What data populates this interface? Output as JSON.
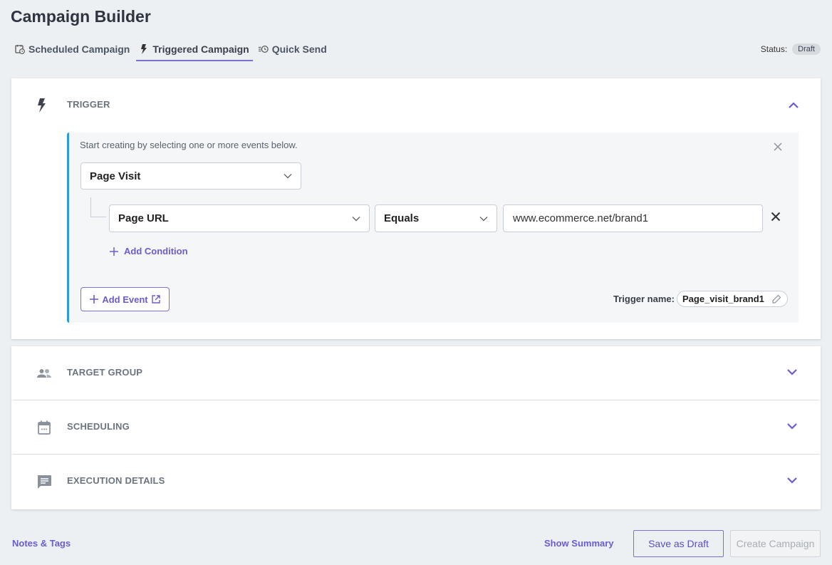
{
  "page": {
    "title": "Campaign Builder"
  },
  "tabs": [
    {
      "label": "Scheduled Campaign",
      "icon": "calendar-clock-icon",
      "active": false
    },
    {
      "label": "Triggered Campaign",
      "icon": "lightning-icon",
      "active": true
    },
    {
      "label": "Quick Send",
      "icon": "list-clock-icon",
      "active": false
    }
  ],
  "status": {
    "label": "Status:",
    "value": "Draft"
  },
  "trigger": {
    "title": "TRIGGER",
    "icon": "lightning-icon",
    "expanded": true,
    "hint": "Start creating by selecting one or more events below.",
    "event_select": "Page Visit",
    "condition": {
      "field": "Page URL",
      "operator": "Equals",
      "value": "www.ecommerce.net/brand1"
    },
    "add_condition_label": "Add Condition",
    "add_event_label": "Add Event",
    "trigger_name_label": "Trigger name:",
    "trigger_name_value": "Page_visit_brand1"
  },
  "sections": [
    {
      "title": "TARGET GROUP",
      "icon": "people-icon"
    },
    {
      "title": "SCHEDULING",
      "icon": "calendar-icon"
    },
    {
      "title": "EXECUTION DETAILS",
      "icon": "chat-icon"
    }
  ],
  "footer": {
    "notes_label": "Notes & Tags",
    "show_summary_label": "Show Summary",
    "save_draft_label": "Save as Draft",
    "create_label": "Create Campaign"
  },
  "colors": {
    "accent": "#6a5cd0",
    "panel_border": "#2f9bd6",
    "background": "#edf0f3"
  }
}
